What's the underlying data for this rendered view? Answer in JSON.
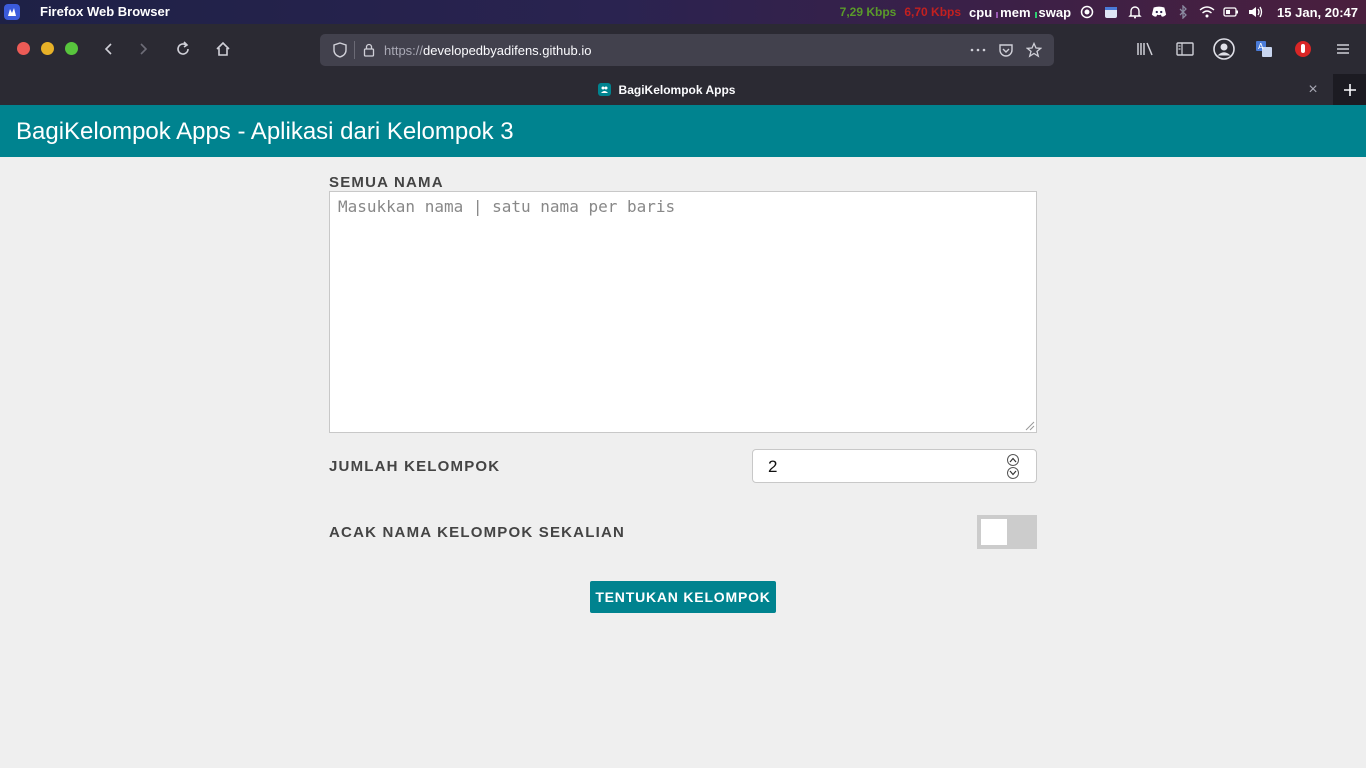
{
  "system_bar": {
    "app_title": "Firefox Web Browser",
    "net_up": "7,29 Kbps",
    "net_down": "6,70 Kbps",
    "cpu_label": "cpu",
    "mem_label": "mem",
    "swap_label": "swap",
    "clock": "15 Jan, 20:47",
    "colors": {
      "net_up": "#5a9a2a",
      "net_down": "#c22020"
    }
  },
  "browser": {
    "url_scheme": "https://",
    "url_host": "developedbyadifens.github.io",
    "tab_title": "BagiKelompok Apps"
  },
  "app": {
    "header_title": "BagiKelompok Apps - Aplikasi dari Kelompok 3",
    "accent_color": "#00838f",
    "names_label": "SEMUA NAMA",
    "names_placeholder": "Masukkan nama | satu nama per baris",
    "names_value": "",
    "group_count_label": "JUMLAH KELOMPOK",
    "group_count_value": "2",
    "shuffle_label": "ACAK NAMA KELOMPOK SEKALIAN",
    "shuffle_enabled": false,
    "submit_label": "TENTUKAN KELOMPOK"
  }
}
